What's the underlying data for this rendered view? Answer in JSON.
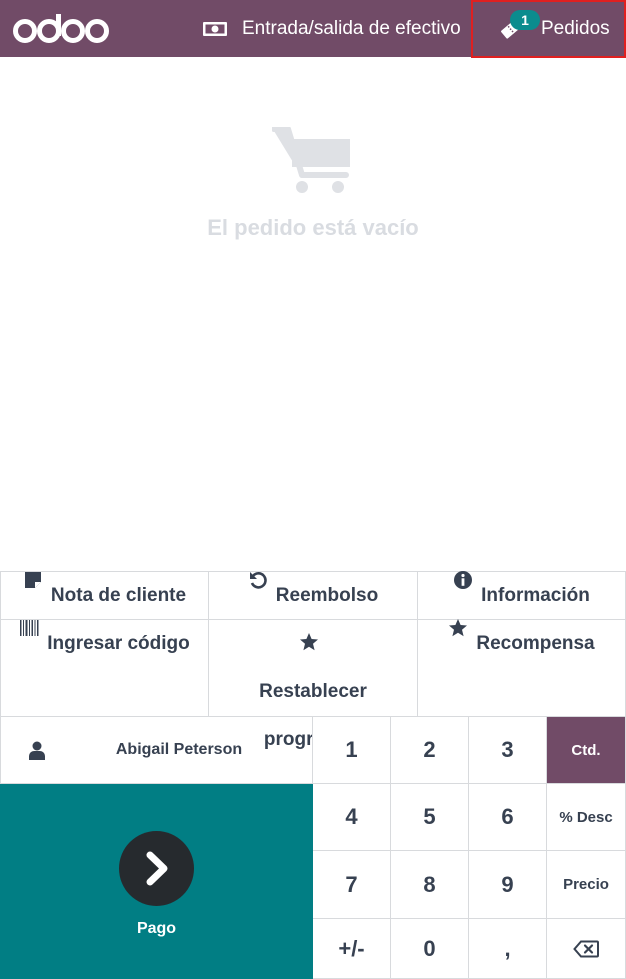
{
  "header": {
    "logo_text": "odoo",
    "cash_in_out_label": "Entrada/salida de efectivo",
    "cash_icon": "money-icon",
    "orders_label": "Pedidos",
    "orders_icon": "ticket-icon",
    "orders_badge": "1",
    "brand_color": "#714b67",
    "badge_color": "#0b8c8e"
  },
  "order": {
    "empty_icon": "shopping-cart-icon",
    "empty_message": "El pedido está vacío"
  },
  "controls": [
    {
      "key": "customer-note",
      "label": "Nota de cliente",
      "icon": "sticky-note-icon"
    },
    {
      "key": "refund",
      "label": "Reembolso",
      "icon": "undo-icon"
    },
    {
      "key": "info",
      "label": "Información",
      "icon": "info-circle-icon"
    },
    {
      "key": "enter-code",
      "label": "Ingresar código",
      "icon": "barcode-icon"
    },
    {
      "key": "reset-programs",
      "label": "Restablecer programas",
      "icon": "star-icon"
    },
    {
      "key": "reward",
      "label": "Recompensa",
      "icon": "star-icon"
    }
  ],
  "customer": {
    "name": "Abigail Peterson",
    "icon": "user-icon"
  },
  "payment": {
    "label": "Pago",
    "icon": "chevron-right-icon",
    "color": "#017e84"
  },
  "numpad": {
    "keys": [
      "1",
      "2",
      "3",
      "Ctd.",
      "4",
      "5",
      "6",
      "% Desc",
      "7",
      "8",
      "9",
      "Precio",
      "+/-",
      "0",
      ",",
      "backspace"
    ],
    "active_mode": "Ctd.",
    "backspace_icon": "backspace-icon"
  }
}
